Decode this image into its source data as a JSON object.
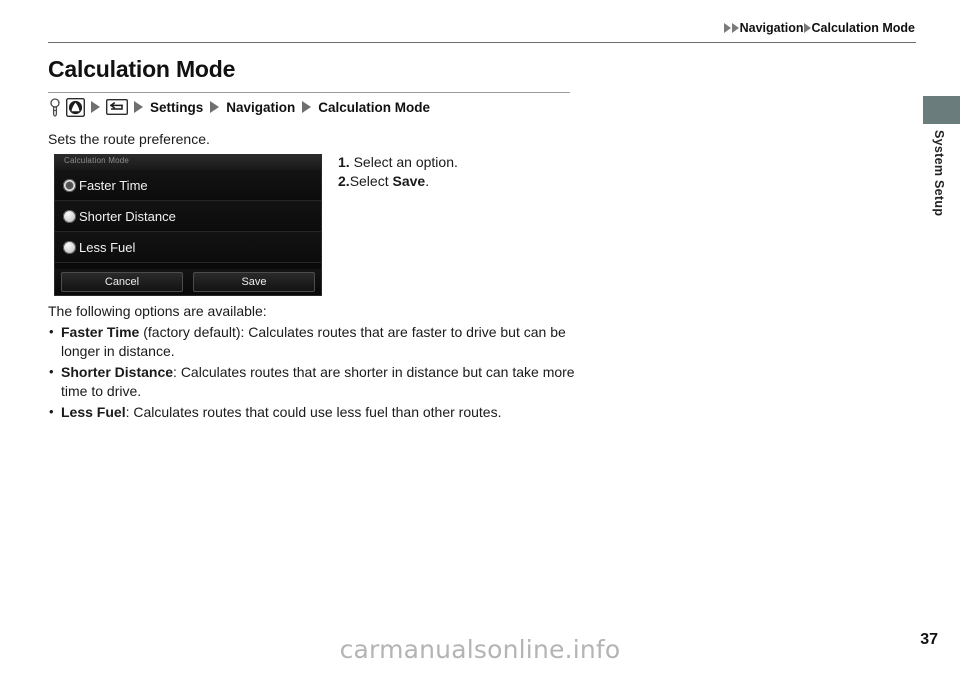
{
  "header": {
    "breadcrumb": [
      {
        "type": "triangle",
        "icon": "triangle-right-icon"
      },
      {
        "type": "triangle",
        "icon": "triangle-right-icon"
      },
      {
        "type": "text",
        "label": "Navigation"
      },
      {
        "type": "triangle",
        "icon": "triangle-right-icon"
      },
      {
        "type": "text",
        "label": "Calculation Mode"
      }
    ]
  },
  "side_tab": {
    "label": "System Setup",
    "color": "#6b7c7d"
  },
  "page": {
    "title": "Calculation Mode",
    "intro": "Sets the route preference.",
    "page_number": "37",
    "watermark": "carmanualsonline.info"
  },
  "menu_path": {
    "icons": [
      "ignition-key-icon",
      "home-nav-button-icon",
      "triangle-right-icon",
      "back-button-icon",
      "triangle-right-icon"
    ],
    "items": [
      "Settings",
      "Navigation",
      "Calculation Mode"
    ]
  },
  "device_screen": {
    "title": "Calculation Mode",
    "options": [
      {
        "label": "Faster Time",
        "selected": true
      },
      {
        "label": "Shorter Distance",
        "selected": false
      },
      {
        "label": "Less Fuel",
        "selected": false
      }
    ],
    "cancel_label": "Cancel",
    "save_label": "Save"
  },
  "steps": {
    "step1_num": "1.",
    "step1_text": "Select an option.",
    "step2_num": "2.",
    "step2_text_before": "Select ",
    "step2_bold": "Save",
    "step2_text_after": "."
  },
  "body": {
    "lead": "The following options are available:",
    "bullets": [
      {
        "term": "Faster Time",
        "rest": " (factory default): Calculates routes that are faster to drive but can be longer in distance."
      },
      {
        "term": "Shorter Distance",
        "rest": ": Calculates routes that are shorter in distance but can take more time to drive."
      },
      {
        "term": "Less Fuel",
        "rest": ": Calculates routes that could use less fuel than other routes."
      }
    ]
  }
}
